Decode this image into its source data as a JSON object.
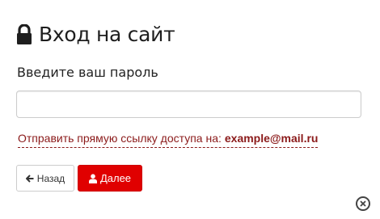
{
  "dialog": {
    "title": "Вход на сайт",
    "title_icon": "lock-icon",
    "password_label": "Введите ваш пароль",
    "password_value": "",
    "password_placeholder": "",
    "send_link": {
      "text": "Отправить прямую ссылку доступа на:",
      "email": "example@mail.ru"
    },
    "buttons": {
      "back_label": "Назад",
      "back_icon": "arrow-left-icon",
      "next_label": "Далее",
      "next_icon": "user-icon"
    },
    "close_icon": "close-icon"
  },
  "colors": {
    "accent": "#e00000",
    "link": "#8b1a1a",
    "text": "#222222"
  }
}
